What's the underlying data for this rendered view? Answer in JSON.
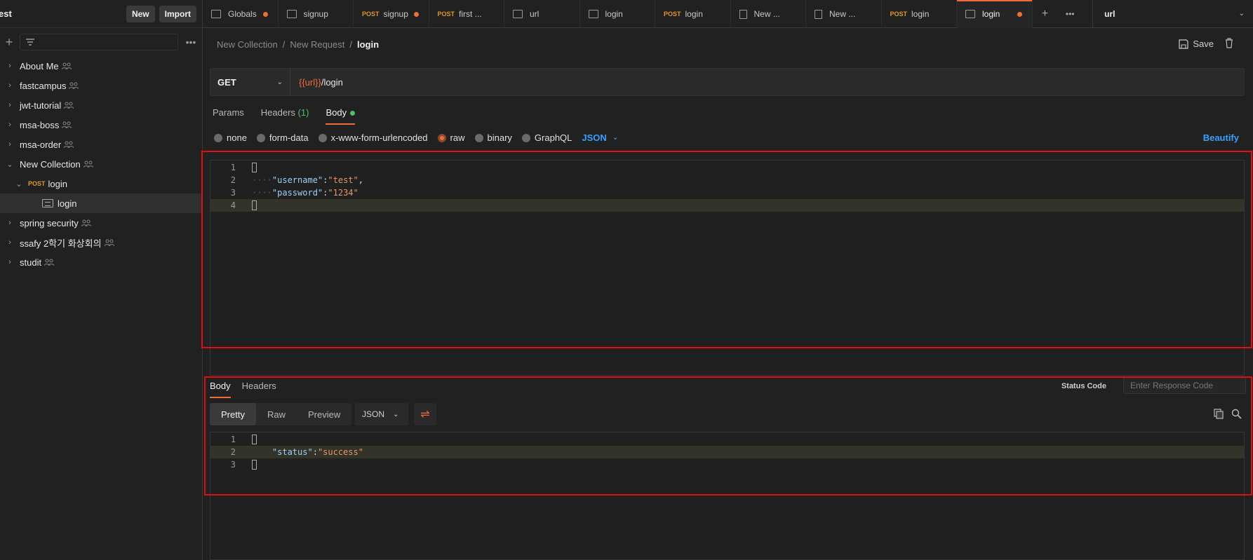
{
  "sidebar": {
    "workspace_name": "est",
    "new_label": "New",
    "import_label": "Import",
    "collections": [
      {
        "label": "About Me"
      },
      {
        "label": "fastcampus"
      },
      {
        "label": "jwt-tutorial"
      },
      {
        "label": "msa-boss"
      },
      {
        "label": "msa-order"
      },
      {
        "label": "New Collection"
      },
      {
        "label": "login",
        "method": "POST"
      },
      {
        "label": "login"
      },
      {
        "label": "spring security"
      },
      {
        "label": "ssafy 2학기 화상회의"
      },
      {
        "label": "studit"
      }
    ]
  },
  "tabs": [
    {
      "label": "Globals",
      "method": "",
      "dirty": true
    },
    {
      "label": "signup",
      "method": "",
      "dirty": false
    },
    {
      "label": "signup",
      "method": "POST",
      "dirty": true
    },
    {
      "label": "first ...",
      "method": "POST",
      "dirty": false
    },
    {
      "label": "url",
      "method": "",
      "dirty": false
    },
    {
      "label": "login",
      "method": "",
      "dirty": false
    },
    {
      "label": "login",
      "method": "POST",
      "dirty": false
    },
    {
      "label": "New ...",
      "method": "",
      "dirty": false
    },
    {
      "label": "New ...",
      "method": "",
      "dirty": false
    },
    {
      "label": "login",
      "method": "POST",
      "dirty": false
    },
    {
      "label": "login",
      "method": "",
      "dirty": true,
      "active": true
    }
  ],
  "environment": {
    "selected": "url"
  },
  "breadcrumb": {
    "part1": "New Collection",
    "part2": "New Request",
    "current": "login",
    "sep": "/"
  },
  "save_label": "Save",
  "request": {
    "method": "GET",
    "url_var": "{{url}}",
    "url_path": "/login",
    "tabs": {
      "params": "Params",
      "headers": "Headers",
      "headers_count": "(1)",
      "body": "Body"
    },
    "body_types": [
      "none",
      "form-data",
      "x-www-form-urlencoded",
      "raw",
      "binary",
      "GraphQL"
    ],
    "body_lang": "JSON",
    "beautify": "Beautify",
    "body_lines": {
      "l1": "1",
      "l2": "2",
      "l3": "3",
      "l4": "4",
      "key1": "\"username\"",
      "val1": "\"test\"",
      "key2": "\"password\"",
      "val2": "\"1234\""
    }
  },
  "response": {
    "tabs": {
      "body": "Body",
      "headers": "Headers"
    },
    "status_label": "Status Code",
    "status_placeholder": "Enter Response Code",
    "views": {
      "pretty": "Pretty",
      "raw": "Raw",
      "preview": "Preview"
    },
    "lang": "JSON",
    "body_lines": {
      "l1": "1",
      "l2": "2",
      "l3": "3",
      "key": "\"status\"",
      "val": "\"success\""
    }
  },
  "colors": {
    "accent": "#f06d3a",
    "post": "#e0962c",
    "link": "#3aa0ff",
    "success": "#4fbf6a",
    "highlight": "#e01010"
  }
}
